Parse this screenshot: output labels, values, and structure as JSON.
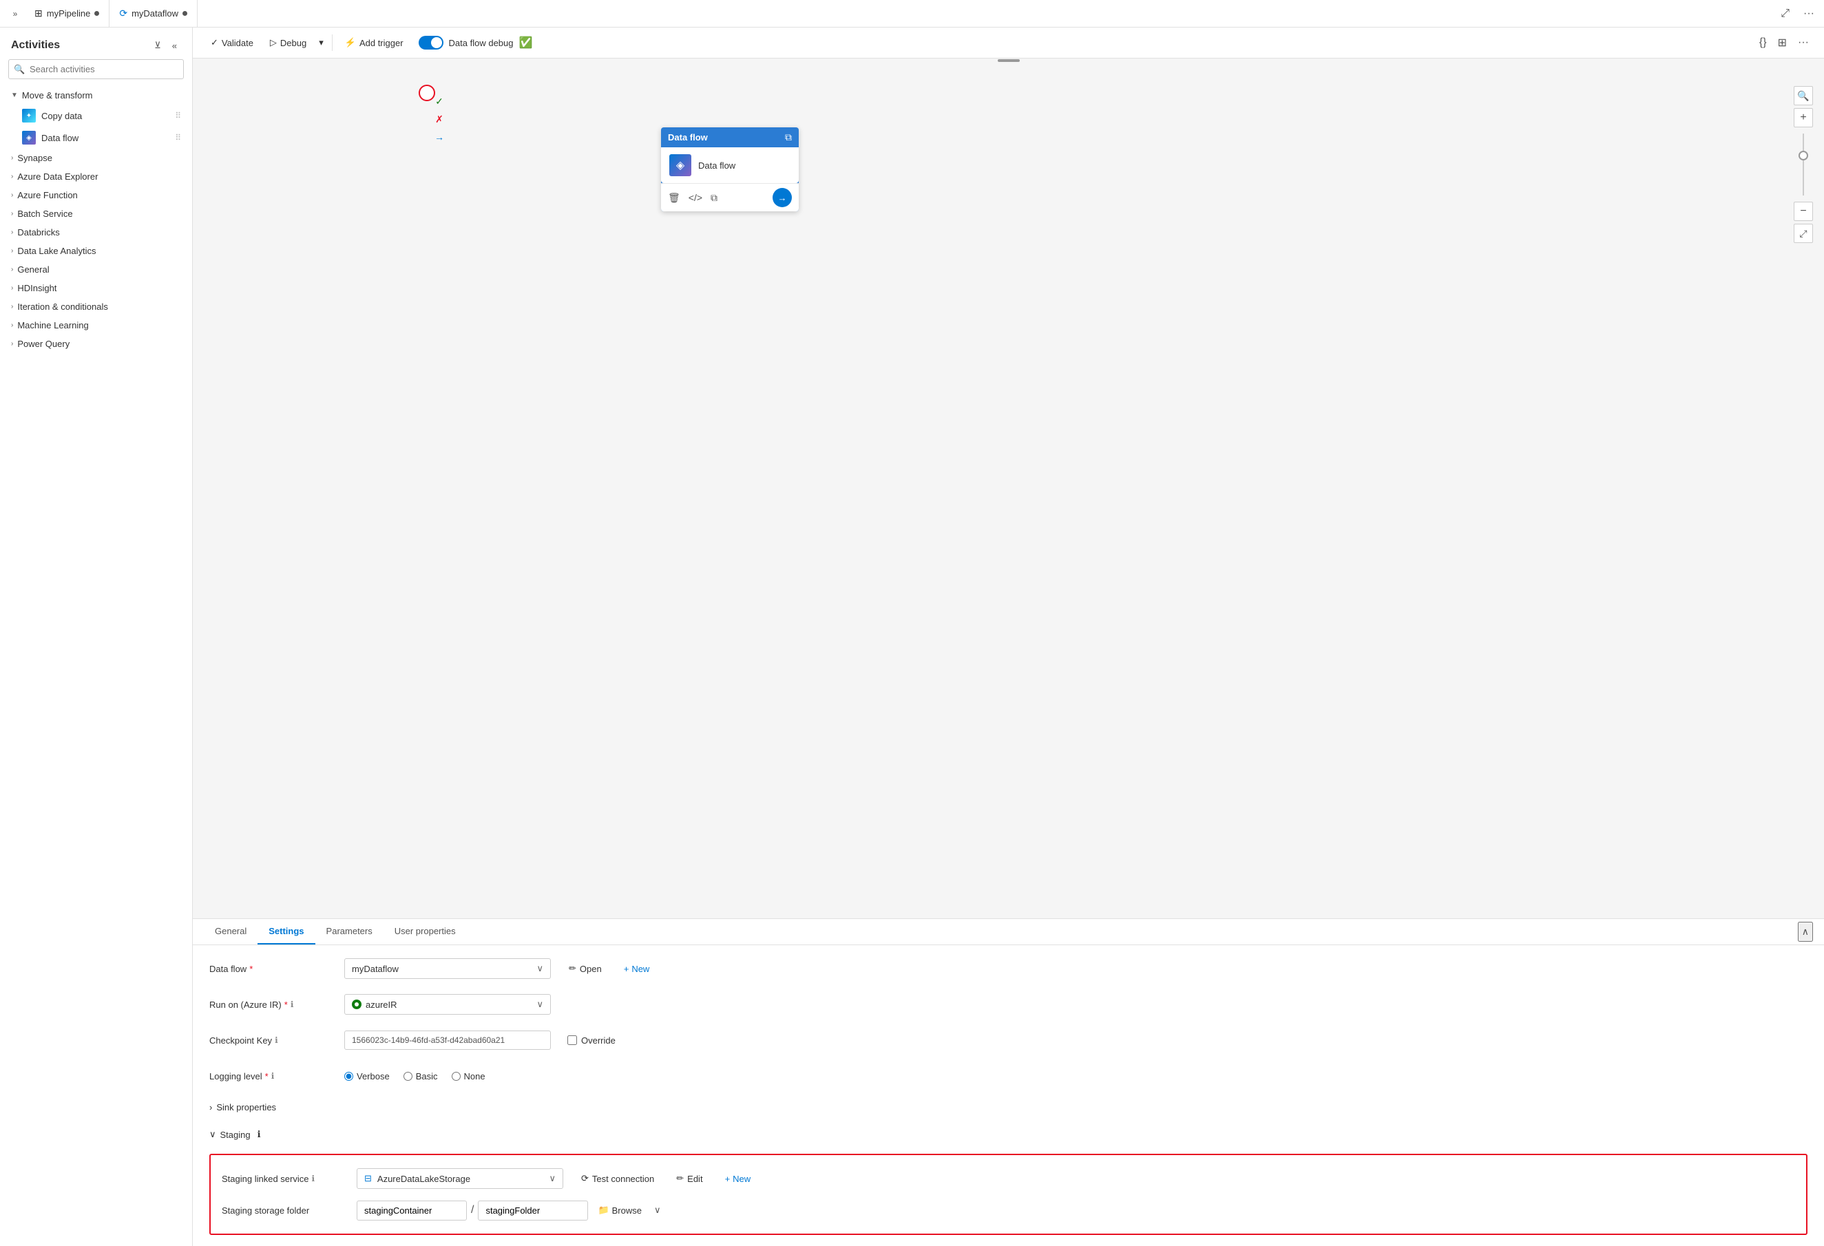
{
  "tabs": [
    {
      "id": "pipeline",
      "label": "myPipeline",
      "icon": "⊞",
      "hasDot": true
    },
    {
      "id": "dataflow",
      "label": "myDataflow",
      "icon": "⟳",
      "hasDot": true
    }
  ],
  "toolbar": {
    "validate_label": "Validate",
    "debug_label": "Debug",
    "add_trigger_label": "Add trigger",
    "debug_toggle_label": "Data flow debug",
    "json_btn": "{}",
    "more_btn": "..."
  },
  "sidebar": {
    "title": "Activities",
    "search_placeholder": "Search activities",
    "sections": [
      {
        "id": "move-transform",
        "label": "Move & transform",
        "expanded": true
      },
      {
        "id": "synapse",
        "label": "Synapse",
        "expanded": false
      },
      {
        "id": "azure-data-explorer",
        "label": "Azure Data Explorer",
        "expanded": false
      },
      {
        "id": "azure-function",
        "label": "Azure Function",
        "expanded": false
      },
      {
        "id": "batch-service",
        "label": "Batch Service",
        "expanded": false
      },
      {
        "id": "databricks",
        "label": "Databricks",
        "expanded": false
      },
      {
        "id": "data-lake-analytics",
        "label": "Data Lake Analytics",
        "expanded": false
      },
      {
        "id": "general",
        "label": "General",
        "expanded": false
      },
      {
        "id": "hdinsight",
        "label": "HDInsight",
        "expanded": false
      },
      {
        "id": "iteration-conditionals",
        "label": "Iteration & conditionals",
        "expanded": false
      },
      {
        "id": "machine-learning",
        "label": "Machine Learning",
        "expanded": false
      },
      {
        "id": "power-query",
        "label": "Power Query",
        "expanded": false
      }
    ],
    "activities": [
      {
        "id": "copy-data",
        "label": "Copy data",
        "section": "move-transform"
      },
      {
        "id": "data-flow",
        "label": "Data flow",
        "section": "move-transform"
      }
    ]
  },
  "canvas": {
    "node": {
      "title": "Data flow",
      "subtitle": "Data flow"
    }
  },
  "bottom_panel": {
    "tabs": [
      {
        "id": "general",
        "label": "General"
      },
      {
        "id": "settings",
        "label": "Settings",
        "active": true
      },
      {
        "id": "parameters",
        "label": "Parameters"
      },
      {
        "id": "user-properties",
        "label": "User properties"
      }
    ],
    "settings": {
      "dataflow_label": "Data flow",
      "dataflow_required": true,
      "dataflow_value": "myDataflow",
      "dataflow_open_btn": "Open",
      "dataflow_new_btn": "New",
      "run_on_label": "Run on (Azure IR)",
      "run_on_required": true,
      "run_on_value": "azureIR",
      "checkpoint_key_label": "Checkpoint Key",
      "checkpoint_key_value": "1566023c-14b9-46fd-a53f-d42abad60a21",
      "checkpoint_override_label": "Override",
      "logging_level_label": "Logging level",
      "logging_level_required": true,
      "logging_verbose": "Verbose",
      "logging_basic": "Basic",
      "logging_none": "None",
      "sink_properties_label": "Sink properties",
      "staging_label": "Staging",
      "staging_linked_service_label": "Staging linked service",
      "staging_linked_service_info": true,
      "staging_linked_service_value": "AzureDataLakeStorage",
      "staging_test_connection_btn": "Test connection",
      "staging_edit_btn": "Edit",
      "staging_new_btn": "New",
      "staging_storage_folder_label": "Staging storage folder",
      "staging_container_value": "stagingContainer",
      "staging_folder_value": "stagingFolder",
      "staging_browse_btn": "Browse"
    }
  }
}
